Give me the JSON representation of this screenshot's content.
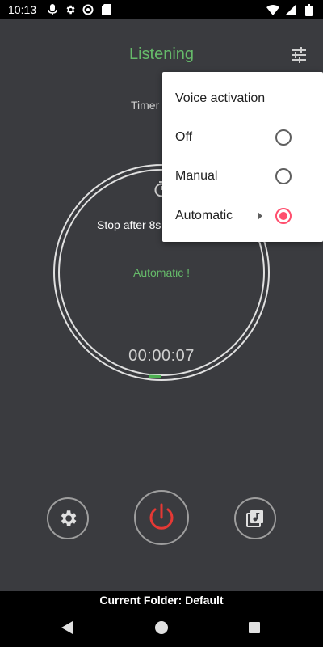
{
  "status_bar": {
    "time": "10:13",
    "icons_left": [
      "mic-icon",
      "gear-icon",
      "sync-icon",
      "sd-card-icon"
    ],
    "icons_right": [
      "wifi-icon",
      "signal-icon",
      "battery-icon"
    ]
  },
  "app_bar": {
    "title": "Listening",
    "title_color": "#66bb6a",
    "menu_icon": "tune-icon"
  },
  "timer": {
    "label": "Timer",
    "stop_after": "Stop after 8s",
    "mode_text": "Automatic !",
    "elapsed": "00:00:07"
  },
  "controls": {
    "settings_icon": "gear-icon",
    "power_icon": "power-icon",
    "power_color": "#e53935",
    "library_icon": "music-library-icon"
  },
  "footer": {
    "current_folder": "Current Folder:  Default"
  },
  "popup_menu": {
    "title": "Voice activation",
    "items": [
      {
        "label": "Off",
        "checked": false
      },
      {
        "label": "Manual",
        "checked": false
      },
      {
        "label": "Automatic",
        "checked": true,
        "has_submenu": true
      }
    ],
    "accent_color": "#ff4f6e"
  }
}
